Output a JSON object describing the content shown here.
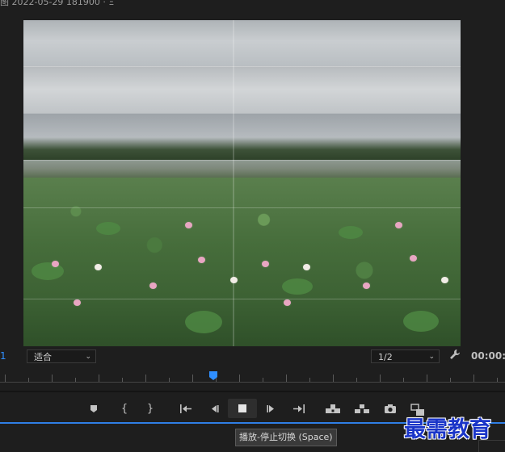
{
  "header": {
    "title_fragment": "图 2022-05-29 181900 · Ξ"
  },
  "monitor": {
    "edge_number": "1",
    "zoom_select": {
      "value": "适合"
    },
    "resolution_select": {
      "value": "1/2"
    },
    "timecode": "00:00:"
  },
  "transport": {
    "stop_tooltip": "播放-停止切换 (Space)"
  },
  "watermark": {
    "text": "最需教育"
  },
  "colors": {
    "accent": "#2f8fff",
    "timeline_line": "#2f7fe6",
    "watermark": "#1a35c8"
  },
  "icons": [
    "marker-icon",
    "mark-in-icon",
    "mark-out-icon",
    "go-to-in-icon",
    "step-back-icon",
    "stop-icon",
    "step-forward-icon",
    "go-to-out-icon",
    "lift-icon",
    "extract-icon",
    "export-frame-icon",
    "compare-view-icon",
    "wrench-icon"
  ]
}
